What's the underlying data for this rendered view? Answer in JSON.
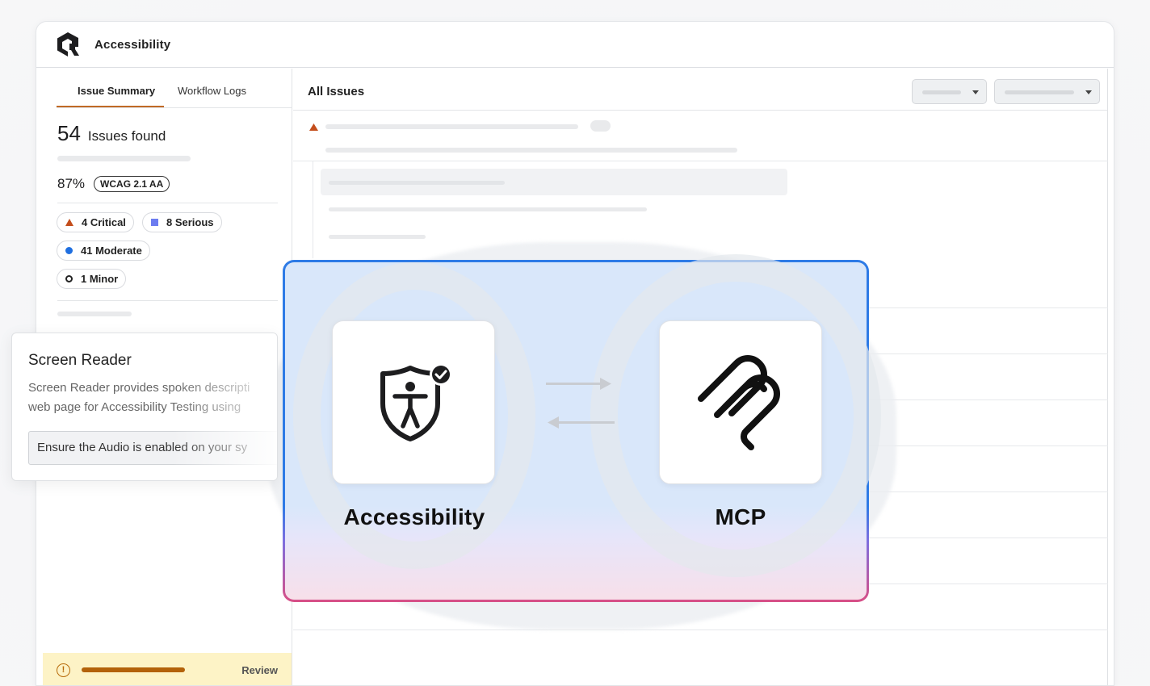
{
  "window": {
    "title": "Accessibility"
  },
  "tabs": [
    {
      "label": "Issue Summary",
      "active": true
    },
    {
      "label": "Workflow Logs",
      "active": false
    }
  ],
  "summary": {
    "count": "54",
    "count_label": "Issues found",
    "score": "87%",
    "standard": "WCAG 2.1 AA"
  },
  "severity": [
    {
      "label": "4 Critical",
      "icon": "triangle-icon",
      "color": "#c44e1c"
    },
    {
      "label": "8 Serious",
      "icon": "square-icon",
      "color": "#6c7cf0"
    },
    {
      "label": "41 Moderate",
      "icon": "dot-icon",
      "color": "#1f6fe0"
    },
    {
      "label": "1 Minor",
      "icon": "ring-icon",
      "color": "#222222"
    }
  ],
  "review": {
    "label": "Review",
    "icon": "alert-circle-icon",
    "color": "#b3620a"
  },
  "main": {
    "title": "All Issues"
  },
  "screen_reader": {
    "title": "Screen Reader",
    "description": "Screen Reader provides spoken descripti\nweb page for Accessibility Testing using",
    "input_value": "Ensure the Audio is enabled on your sy"
  },
  "integration": {
    "left_label": "Accessibility",
    "left_icon": "accessibility-shield-icon",
    "right_label": "MCP",
    "right_icon": "mcp-icon",
    "border_colors": [
      "#2e7be6",
      "#7d6fe0",
      "#d84f86"
    ]
  }
}
